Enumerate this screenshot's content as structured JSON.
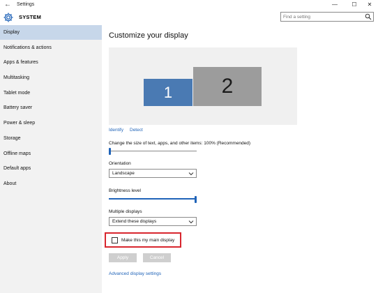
{
  "window": {
    "title": "Settings",
    "back_glyph": "←",
    "minimize_glyph": "—",
    "maximize_glyph": "☐",
    "close_glyph": "✕"
  },
  "header": {
    "section": "SYSTEM",
    "icon": "gear-icon"
  },
  "search": {
    "placeholder": "Find a setting",
    "icon": "search-icon"
  },
  "sidebar": {
    "items": [
      {
        "label": "Display",
        "active": true
      },
      {
        "label": "Notifications & actions"
      },
      {
        "label": "Apps & features"
      },
      {
        "label": "Multitasking"
      },
      {
        "label": "Tablet mode"
      },
      {
        "label": "Battery saver"
      },
      {
        "label": "Power & sleep"
      },
      {
        "label": "Storage"
      },
      {
        "label": "Offline maps"
      },
      {
        "label": "Default apps"
      },
      {
        "label": "About"
      }
    ]
  },
  "main": {
    "title": "Customize your display",
    "monitors": [
      {
        "label": "1",
        "color": "#4a7ab3"
      },
      {
        "label": "2",
        "color": "#9c9c9c"
      }
    ],
    "identify_link": "Identify",
    "detect_link": "Detect",
    "scale": {
      "label": "Change the size of text, apps, and other items: 100% (Recommended)",
      "level": 0.0
    },
    "orientation": {
      "label": "Orientation",
      "value": "Landscape"
    },
    "brightness": {
      "label": "Brightness level",
      "level": 1.0
    },
    "multiple_displays": {
      "label": "Multiple displays",
      "value": "Extend these displays"
    },
    "main_display_checkbox": {
      "label": "Make this my main display",
      "checked": false
    },
    "apply_button": "Apply",
    "cancel_button": "Cancel",
    "advanced_link": "Advanced display settings"
  },
  "colors": {
    "accent": "#1f63b8",
    "sidebar_active": "#c7d7ea",
    "highlight_border": "#d8262e"
  }
}
